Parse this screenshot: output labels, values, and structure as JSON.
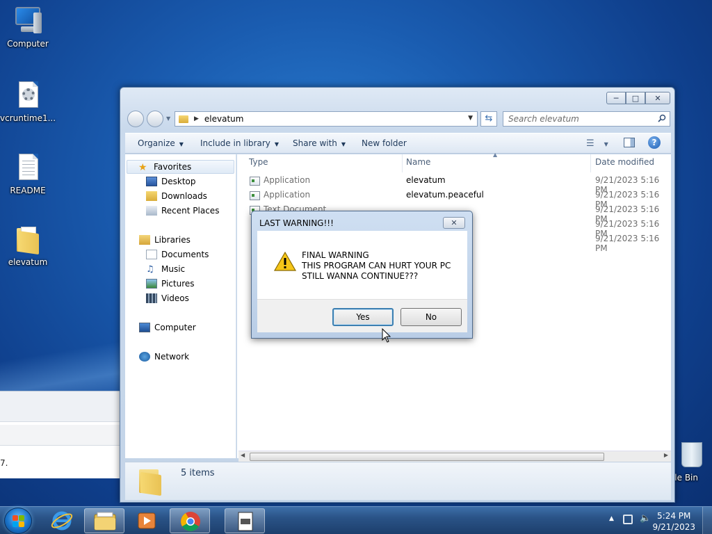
{
  "desktop": {
    "icons": [
      {
        "label": "Computer"
      },
      {
        "label": "vcruntime1..."
      },
      {
        "label": "README"
      },
      {
        "label": "elevatum"
      },
      {
        "label": "cle Bin"
      }
    ]
  },
  "background_window": {
    "partial_text": "7."
  },
  "explorer": {
    "address_path": "elevatum",
    "search_placeholder": "Search elevatum",
    "toolbar": {
      "organize": "Organize",
      "include_in_library": "Include in library",
      "share_with": "Share with",
      "new_folder": "New folder"
    },
    "nav": {
      "favorites": "Favorites",
      "desktop": "Desktop",
      "downloads": "Downloads",
      "recent_places": "Recent Places",
      "libraries": "Libraries",
      "documents": "Documents",
      "music": "Music",
      "pictures": "Pictures",
      "videos": "Videos",
      "computer": "Computer",
      "network": "Network"
    },
    "columns": {
      "type": "Type",
      "name": "Name",
      "date_modified": "Date modified"
    },
    "files": [
      {
        "type": "Application",
        "name": "elevatum",
        "date": "9/21/2023 5:16 PM"
      },
      {
        "type": "Application",
        "name": "elevatum.peaceful",
        "date": "9/21/2023 5:16 PM"
      },
      {
        "type": "Text Document",
        "name": "",
        "date": "9/21/2023 5:16 PM"
      },
      {
        "type": "",
        "name": "",
        "date": "9/21/2023 5:16 PM"
      },
      {
        "type": "",
        "name": "",
        "date": "9/21/2023 5:16 PM"
      }
    ],
    "status": {
      "item_count": "5 items"
    }
  },
  "dialog": {
    "title": "LAST WARNING!!!",
    "line1": "FINAL WARNING",
    "line2": "THIS PROGRAM CAN HURT YOUR PC",
    "line3": "STILL WANNA CONTINUE???",
    "yes_label": "Yes",
    "no_label": "No"
  },
  "taskbar": {
    "time": "5:24 PM",
    "date": "9/21/2023",
    "pinned": [
      "internet-explorer-icon",
      "windows-explorer-icon",
      "media-player-icon",
      "chrome-icon",
      "elevatum-app-icon"
    ]
  },
  "colors": {
    "desktop_blue": "#1a5cb0",
    "taskbar": "#2a5387",
    "dialog_default_border": "#3c7fb1"
  }
}
